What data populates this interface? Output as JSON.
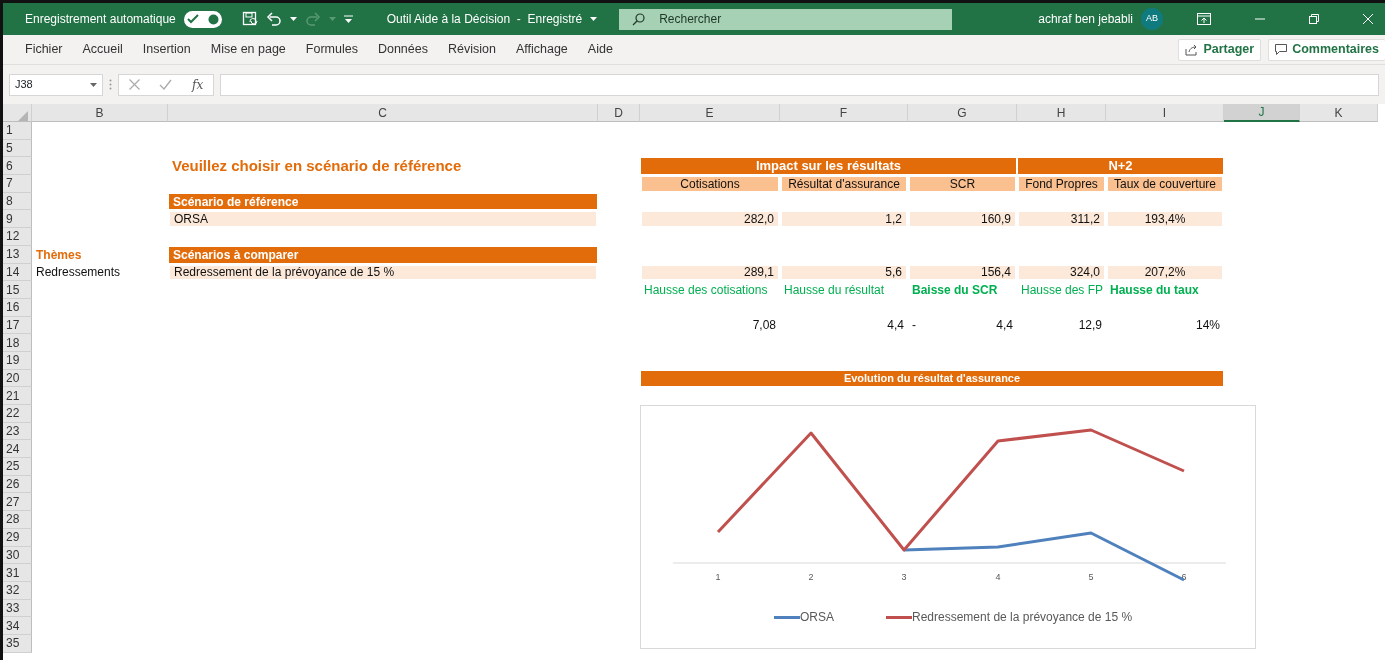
{
  "title_bar": {
    "autosave_label": "Enregistrement automatique",
    "autosave_on": true,
    "redo_disabled": true,
    "document_title": "Outil Aide à la Décision  -  Enregistré",
    "search": {
      "placeholder": "Rechercher"
    },
    "user_name": "achraf ben jebabli",
    "avatar_initials": "AB"
  },
  "ribbon": {
    "tabs": [
      "Fichier",
      "Accueil",
      "Insertion",
      "Mise en page",
      "Formules",
      "Données",
      "Révision",
      "Affichage",
      "Aide"
    ],
    "share_button": "Partager",
    "comments_button": "Commentaires"
  },
  "formula_bar": {
    "name_box": "J38",
    "function_label": "fx"
  },
  "columns": [
    {
      "label": "B",
      "selected": false
    },
    {
      "label": "C",
      "selected": false
    },
    {
      "label": "D",
      "selected": false
    },
    {
      "label": "E",
      "selected": false
    },
    {
      "label": "F",
      "selected": false
    },
    {
      "label": "G",
      "selected": false
    },
    {
      "label": "H",
      "selected": false
    },
    {
      "label": "I",
      "selected": false
    },
    {
      "label": "J",
      "selected": true
    },
    {
      "label": "K",
      "selected": false
    }
  ],
  "rows": [
    "1",
    "5",
    "6",
    "7",
    "8",
    "9",
    "12",
    "13",
    "14",
    "15",
    "16",
    "17",
    "18",
    "19",
    "20",
    "21",
    "22",
    "23",
    "24",
    "25",
    "26",
    "27",
    "28",
    "29",
    "30",
    "31",
    "32",
    "33",
    "34",
    "35"
  ],
  "sheet": {
    "title": "Veuillez choisir en scénario de référence",
    "reference": {
      "header": "Scénario de référence",
      "value": "ORSA"
    },
    "themes": {
      "header": "Thèmes",
      "value": "Redressements"
    },
    "comparison": {
      "header": "Scénarios à comparer",
      "value": "Redressement de la prévoyance de 15 %"
    },
    "impact_table": {
      "groups": [
        "Impact sur les résultats",
        "N+2"
      ],
      "columns": [
        "Cotisations",
        "Résultat d'assurance",
        "SCR",
        "Fond Propres",
        "Taux de couverture"
      ],
      "reference_row": [
        "282,0",
        "1,2",
        "160,9",
        "311,2",
        "193,4%"
      ],
      "comparison_row": [
        "289,1",
        "5,6",
        "156,4",
        "324,0",
        "207,2%"
      ],
      "change_labels": [
        {
          "text": "Hausse des cotisations",
          "bold": false
        },
        {
          "text": "Hausse du résultat",
          "bold": false
        },
        {
          "text": "Baisse du SCR",
          "bold": true
        },
        {
          "text": "Hausse des FP",
          "bold": false
        },
        {
          "text": "Hausse du taux",
          "bold": true
        }
      ],
      "changes": [
        {
          "value": "7,08"
        },
        {
          "value": "4,4"
        },
        {
          "sign": "-",
          "value": "4,4"
        },
        {
          "value": "12,9"
        },
        {
          "value": "14%"
        }
      ]
    },
    "chart": {
      "title": "Evolution du résultat d'assurance",
      "x_labels": [
        "1",
        "2",
        "3",
        "4",
        "5",
        "6"
      ],
      "legend": [
        {
          "name": "ORSA",
          "color": "#4f81bd"
        },
        {
          "name": "Redressement de la prévoyance de 15 %",
          "color": "#c0504d"
        }
      ]
    }
  }
}
